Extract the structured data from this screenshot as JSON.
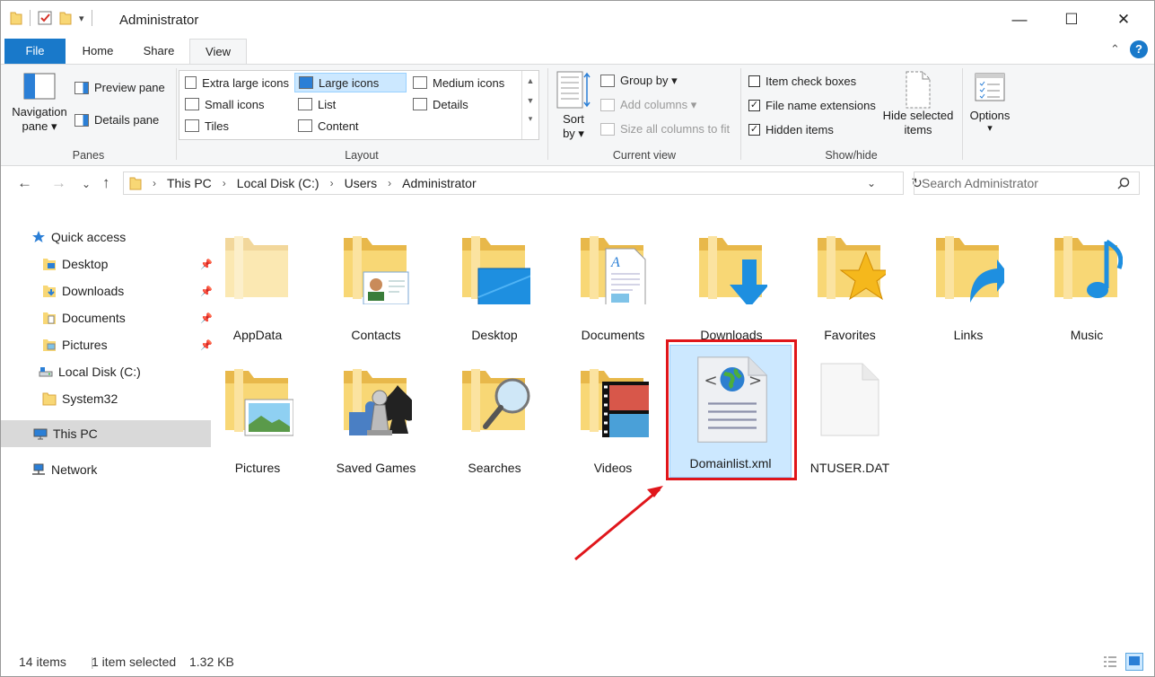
{
  "window": {
    "title": "Administrator",
    "controls": {
      "minimize": "—",
      "maximize": "☐",
      "close": "✕"
    }
  },
  "ribbon": {
    "tabs": [
      "File",
      "Home",
      "Share",
      "View"
    ],
    "active_tab": "View",
    "panes": {
      "label": "Panes",
      "navigation_pane": [
        "Navigation",
        "pane ▾"
      ],
      "preview_pane": "Preview pane",
      "details_pane": "Details pane"
    },
    "layout": {
      "label": "Layout",
      "options": [
        "Extra large icons",
        "Large icons",
        "Medium icons",
        "Small icons",
        "List",
        "Details",
        "Tiles",
        "Content"
      ],
      "selected": "Large icons"
    },
    "current_view": {
      "label": "Current view",
      "sort_by": [
        "Sort",
        "by ▾"
      ],
      "group_by": "Group by ▾",
      "add_columns": "Add columns ▾",
      "size_all_columns": "Size all columns to fit"
    },
    "show_hide": {
      "label": "Show/hide",
      "item_check_boxes": {
        "label": "Item check boxes",
        "checked": false
      },
      "file_name_extensions": {
        "label": "File name extensions",
        "checked": true
      },
      "hidden_items": {
        "label": "Hidden items",
        "checked": true
      },
      "hide_selected": [
        "Hide selected",
        "items"
      ]
    },
    "options": {
      "label": "Options",
      "arrow": "▾"
    }
  },
  "address": {
    "crumbs": [
      "This PC",
      "Local Disk (C:)",
      "Users",
      "Administrator"
    ],
    "search_placeholder": "Search Administrator"
  },
  "nav": {
    "items": [
      {
        "label": "Quick access",
        "icon": "star-icon",
        "pinned": false
      },
      {
        "label": "Desktop",
        "icon": "desktop-folder-icon",
        "pinned": true
      },
      {
        "label": "Downloads",
        "icon": "downloads-folder-icon",
        "pinned": true
      },
      {
        "label": "Documents",
        "icon": "documents-folder-icon",
        "pinned": true
      },
      {
        "label": "Pictures",
        "icon": "pictures-folder-icon",
        "pinned": true
      },
      {
        "label": "Local Disk (C:)",
        "icon": "drive-icon",
        "pinned": false
      },
      {
        "label": "System32",
        "icon": "folder-icon",
        "pinned": false
      },
      {
        "label": "This PC",
        "icon": "computer-icon",
        "pinned": false,
        "selected": true
      },
      {
        "label": "Network",
        "icon": "network-icon",
        "pinned": false
      }
    ]
  },
  "files": [
    {
      "name": "AppData",
      "type": "folder-hidden"
    },
    {
      "name": "Contacts",
      "type": "contacts"
    },
    {
      "name": "Desktop",
      "type": "desktop"
    },
    {
      "name": "Documents",
      "type": "documents"
    },
    {
      "name": "Downloads",
      "type": "downloads"
    },
    {
      "name": "Favorites",
      "type": "favorites"
    },
    {
      "name": "Links",
      "type": "links"
    },
    {
      "name": "Music",
      "type": "music"
    },
    {
      "name": "Pictures",
      "type": "pictures"
    },
    {
      "name": "Saved Games",
      "type": "savedgames"
    },
    {
      "name": "Searches",
      "type": "searches"
    },
    {
      "name": "Videos",
      "type": "videos"
    },
    {
      "name": "Domainlist.xml",
      "type": "xml",
      "selected": true
    },
    {
      "name": "NTUSER.DAT",
      "type": "dat"
    }
  ],
  "status": {
    "item_count": "14 items",
    "selected": "1 item selected",
    "size": "1.32 KB"
  },
  "colors": {
    "accent": "#1979ca",
    "folder": "#f8d775",
    "folder_dark": "#e8b84a",
    "selection": "#cce8ff",
    "highlight": "#e0161b"
  }
}
